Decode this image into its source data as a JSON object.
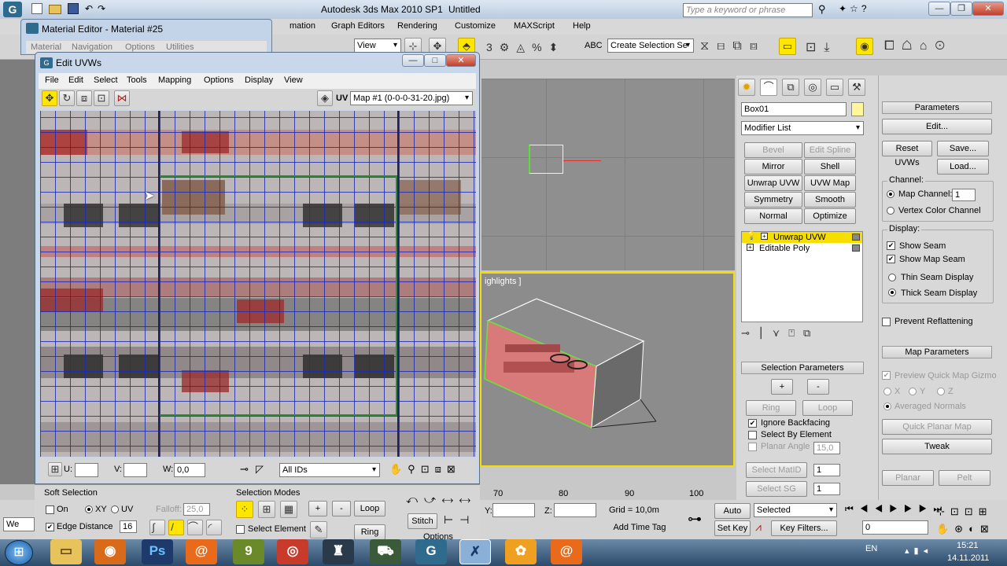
{
  "app": {
    "title": "Autodesk 3ds Max 2010 SP1",
    "doc": "Untitled",
    "search_placeholder": "Type a keyword or phrase",
    "menus": [
      "mation",
      "Graph Editors",
      "Rendering",
      "Customize",
      "MAXScript",
      "Help"
    ],
    "view_select": "View",
    "selection_set": "Create Selection Se"
  },
  "material_editor": {
    "title": "Material Editor - Material #25",
    "menus": [
      "Material",
      "Navigation",
      "Options",
      "Utilities"
    ]
  },
  "uvw": {
    "title": "Edit UVWs",
    "menus": [
      "File",
      "Edit",
      "Select",
      "Tools",
      "Mapping",
      "Options",
      "Display",
      "View"
    ],
    "uv_label": "UV",
    "map_select": "Map #1 (0-0-0-31-20.jpg)",
    "u_label": "U:",
    "v_label": "V:",
    "w_label": "W:",
    "w_value": "0,0",
    "ids_select": "All IDs"
  },
  "soft": {
    "title": "Soft Selection",
    "on": "On",
    "xy": "XY",
    "uv": "UV",
    "falloff_label": "Falloff:",
    "falloff_value": "25,0",
    "edge_distance": "Edge Distance",
    "edge_value": "16"
  },
  "selmodes": {
    "title": "Selection Modes",
    "select_element": "Select Element",
    "loop": "Loop",
    "ring": "Ring",
    "stitch": "Stitch",
    "options": "Options"
  },
  "viewport": {
    "label": "ighlights ]",
    "ruler": [
      "70",
      "80",
      "90",
      "100"
    ],
    "y_label": "Y:",
    "z_label": "Z:",
    "grid": "Grid = 10,0m",
    "add_time_tag": "Add Time Tag"
  },
  "anim": {
    "auto_key": "Auto Key",
    "set_key": "Set Key",
    "selected": "Selected",
    "key_filters": "Key Filters...",
    "frame": "0"
  },
  "cmd": {
    "object_name": "Box01",
    "modifier_list": "Modifier List",
    "buttons": [
      "Bevel",
      "Edit Spline",
      "Mirror",
      "Shell",
      "Unwrap UVW",
      "UVW Map",
      "Symmetry",
      "Smooth",
      "Normal",
      "Optimize"
    ],
    "stack": [
      "Unwrap UVW",
      "Editable Poly"
    ]
  },
  "selparams": {
    "title": "Selection Parameters",
    "plus": "+",
    "minus": "-",
    "ring": "Ring",
    "loop": "Loop",
    "ignore_backfacing": "Ignore Backfacing",
    "select_by_element": "Select By Element",
    "planar_angle": "Planar Angle",
    "planar_value": "15,0",
    "select_matid": "Select MatID",
    "matid_value": "1",
    "select_sg": "Select SG",
    "sg_value": "1"
  },
  "params": {
    "title": "Parameters",
    "edit": "Edit...",
    "reset_uvws": "Reset UVWs",
    "save": "Save...",
    "load": "Load...",
    "channel": "Channel:",
    "map_channel": "Map Channel:",
    "map_channel_value": "1",
    "vertex_color_channel": "Vertex Color Channel",
    "display": "Display:",
    "show_seam": "Show Seam",
    "show_map_seam": "Show Map Seam",
    "thin_seam": "Thin Seam Display",
    "thick_seam": "Thick Seam Display",
    "prevent_reflattening": "Prevent Reflattening"
  },
  "mapparams": {
    "title": "Map Parameters",
    "preview": "Preview Quick Map Gizmo",
    "x": "X",
    "y": "Y",
    "z": "Z",
    "averaged_normals": "Averaged Normals",
    "quick_planar_map": "Quick Planar Map",
    "tweak": "Tweak",
    "planar": "Planar",
    "pelt": "Pelt"
  },
  "taskbar": {
    "lang": "EN",
    "time": "15:21",
    "date": "14.11.2011",
    "welcome": "We"
  },
  "colors": {
    "accent": "#ffe600",
    "title_bar": "#c4d4e8",
    "grid_line": "#1c2bb4",
    "selected_stack": "#f5de00"
  }
}
